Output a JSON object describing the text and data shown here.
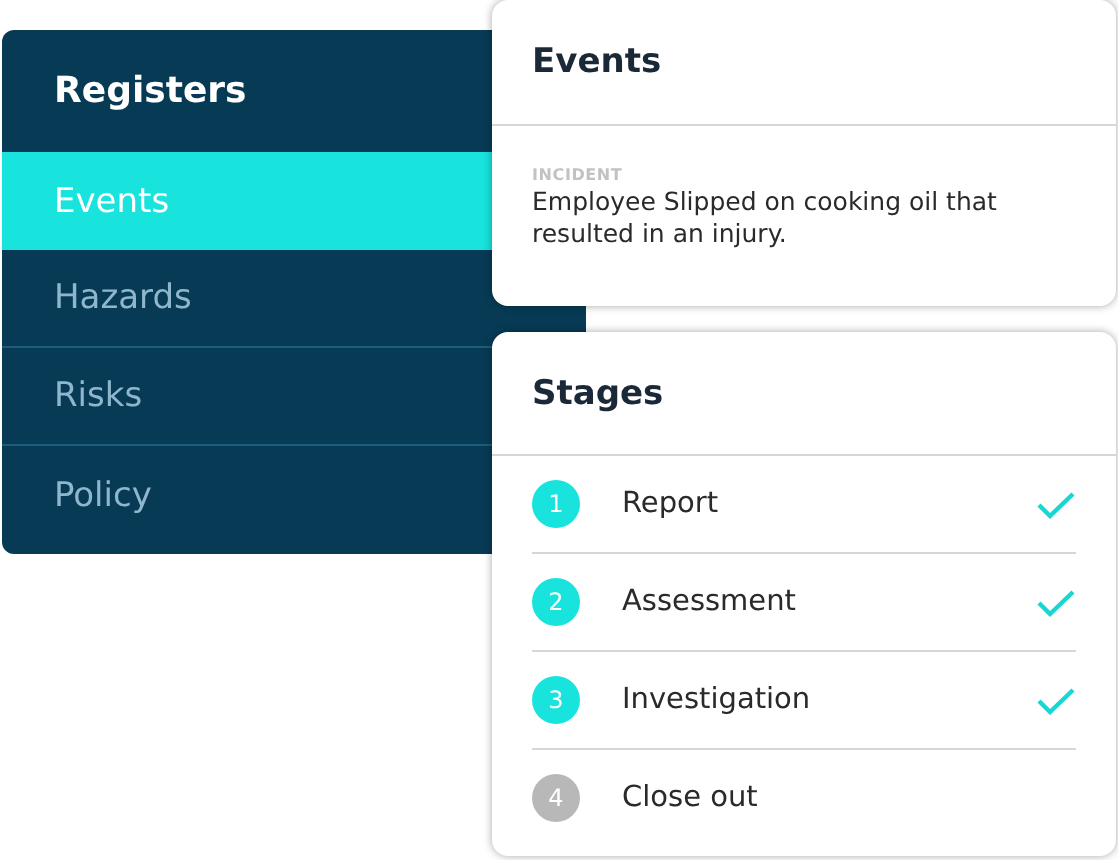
{
  "sidebar": {
    "title": "Registers",
    "items": [
      {
        "label": "Events",
        "selected": true
      },
      {
        "label": "Hazards",
        "selected": false
      },
      {
        "label": "Risks",
        "selected": false
      },
      {
        "label": "Policy",
        "selected": false
      }
    ]
  },
  "events_card": {
    "title": "Events",
    "category": "INCIDENT",
    "description": "Employee Slipped on cooking oil that resulted in an injury."
  },
  "stages_card": {
    "title": "Stages",
    "stages": [
      {
        "number": "1",
        "label": "Report",
        "completed": true
      },
      {
        "number": "2",
        "label": "Assessment",
        "completed": true
      },
      {
        "number": "3",
        "label": "Investigation",
        "completed": true
      },
      {
        "number": "4",
        "label": "Close out",
        "completed": false
      }
    ]
  }
}
